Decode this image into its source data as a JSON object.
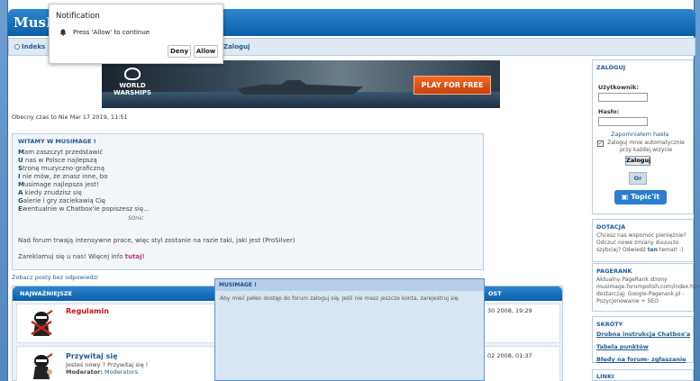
{
  "site": {
    "logo": "MusIm"
  },
  "nav": {
    "index": "Indeks",
    "login": "Zaloguj"
  },
  "banner": {
    "brand_line1": "WORLD",
    "brand_line2": "WARSHIPS",
    "cta": "PLAY FOR FREE"
  },
  "date_text": "Obecny czas to Nie Mar 17 2019, 11:51",
  "welcome": {
    "title": "WITAMY W MUSIMAGE !",
    "poem": [
      {
        "first": "M",
        "rest": "am zaszczyt przedstawić"
      },
      {
        "first": "U",
        "rest": " nas w Polsce najlepszą"
      },
      {
        "first": "S",
        "rest": "tronę muzyczno-graficzną"
      },
      {
        "first": "I",
        "rest": " nie mów, że znasz inne, bo"
      },
      {
        "first": "M",
        "rest": "usimage najlepsza jest!"
      },
      {
        "first": "A",
        "rest": " kiedy znudzisz się"
      },
      {
        "first": "G",
        "rest": "alerie i gry zaciekawią Cię"
      },
      {
        "first": "E",
        "rest": "wentualnie w Chatbox'ie popiszesz się..."
      }
    ],
    "signature": "S0nic",
    "notice": "Nad forum trwają intensywne prace, więc styl zostanie na razie taki, jaki jest (ProSilver)",
    "advert_text": "Zareklamuj się u nas! Więcej info",
    "advert_link": "tutaj!"
  },
  "no_replies": "Zobacz posty bez odpowiedzi",
  "forum": {
    "header": "NAJWAŻNIEJSZE",
    "header_right": "OST",
    "rows": [
      {
        "title": "Regulamin",
        "desc": "",
        "moderator_label": "",
        "moderator": "",
        "date": "30 2008, 19:29"
      },
      {
        "title": "Przywitaj się",
        "desc": "Jesteś nowy ? Przywitaj się !",
        "moderator_label": "Moderator:",
        "moderator": "Moderators",
        "date": "02 2008, 01:37"
      }
    ]
  },
  "modal": {
    "title": "MUSIMAGE !",
    "text": "Aby mieć pełen dostęp do forum zaloguj się. Jeśli nie masz jeszcze konta, zarejestruj się."
  },
  "sidebar": {
    "login": {
      "title": "ZALOGUJ",
      "user_label": "Użytkownik:",
      "pass_label": "Hasło:",
      "forgot": "Zapomniałem hasła",
      "remember": "Zaloguj mnie automatycznie przy każdej wizycie",
      "submit": "Zaloguj",
      "or": "Or",
      "topicit": "Topic'it"
    },
    "donation": {
      "title": "DOTACJA",
      "text": "Chcesz nas wspomóc pieniężnie? Odczuć nowe zmiany duuuużo szybciej? Odwiedź",
      "link": "ten",
      "tail": "temat! :)"
    },
    "pagerank": {
      "title": "PAGERANK",
      "text": "Aktualny PageRank strony musimage.forumpolish.com/index.htm dostarczaj: Google-Pagerank.pl - Pozycjonowanie + SEO"
    },
    "shortcuts": {
      "title": "SKRÓTY",
      "links": [
        "Drobna instrukcja Chatbox'a",
        "Tabela punktów",
        "Błędy na forum- zgłaszanie"
      ]
    },
    "links_title": "LINKI"
  },
  "notification": {
    "title": "Notification",
    "message": "Press 'Allow' to continue",
    "deny": "Deny",
    "allow": "Allow"
  }
}
